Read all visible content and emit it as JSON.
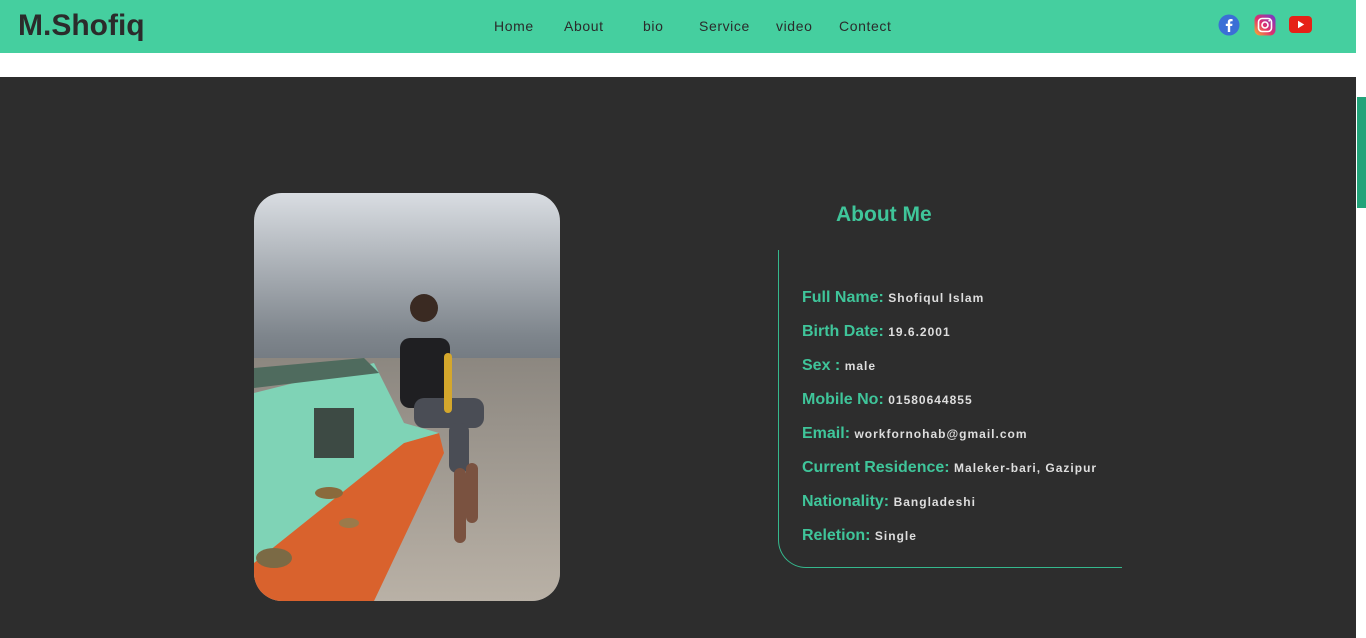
{
  "brand": {
    "logo_text": "M.Shofiq",
    "accent_color": "#45cf9f"
  },
  "nav": {
    "items": [
      {
        "label": "Home"
      },
      {
        "label": "About"
      },
      {
        "label": "bio"
      },
      {
        "label": "Service"
      },
      {
        "label": "video"
      },
      {
        "label": "Contect"
      }
    ],
    "social": [
      {
        "icon": "facebook-icon"
      },
      {
        "icon": "instagram-icon"
      },
      {
        "icon": "youtube-icon"
      }
    ]
  },
  "about": {
    "title": "About Me",
    "rows": [
      {
        "label": "Full Name:",
        "value": "Shofiqul Islam"
      },
      {
        "label": "Birth Date:",
        "value": "19.6.2001"
      },
      {
        "label": "Sex :",
        "value": "male"
      },
      {
        "label": "Mobile No:",
        "value": "01580644855"
      },
      {
        "label": "Email:",
        "value": "workfornohab@gmail.com"
      },
      {
        "label": "Current Residence:",
        "value": "Maleker-bari, Gazipur"
      },
      {
        "label": "Nationality:",
        "value": "Bangladeshi"
      },
      {
        "label": "Reletion:",
        "value": "Single"
      }
    ]
  }
}
